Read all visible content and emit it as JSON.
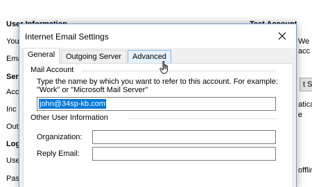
{
  "background": {
    "user_information_heading": "User Information",
    "test_account_heading": "Test Account Setti",
    "fragment_you": "You",
    "fragment_ema": "Ema",
    "fragment_ser": "Ser",
    "fragment_acc": "Acc",
    "fragment_inc": "Inc",
    "fragment_out": "Out",
    "fragment_log": "Log",
    "fragment_use": "Use",
    "fragment_pas": "Pas",
    "right_fragment_1": "We",
    "right_fragment_2": "acc",
    "right_fragment_3": "t Se",
    "right_fragment_4": "atica",
    "right_fragment_5": "e",
    "right_fragment_6": "offlin"
  },
  "dialog": {
    "title": "Internet Email Settings",
    "tabs": [
      {
        "label": "General",
        "state": "active"
      },
      {
        "label": "Outgoing Server",
        "state": "normal"
      },
      {
        "label": "Advanced",
        "state": "hover"
      }
    ],
    "mail_account": {
      "section_label": "Mail Account",
      "description": "Type the name by which you want to refer to this account.  For example: \"Work\" or \"Microsoft Mail Server\"",
      "account_name_value": "john@34sp-kb.com"
    },
    "other_user_information": {
      "section_label": "Other User Information",
      "organization_label": "Organization:",
      "organization_value": "",
      "reply_email_label": "Reply Email:",
      "reply_email_value": ""
    }
  },
  "colors": {
    "selection": "#0078d7",
    "dialog_border": "#6d9bd1",
    "client_bg": "#f0f0f0",
    "tab_hover": "#e5f1fb"
  },
  "icons": {
    "close": "close-icon",
    "cursor": "hand-pointer-icon"
  }
}
